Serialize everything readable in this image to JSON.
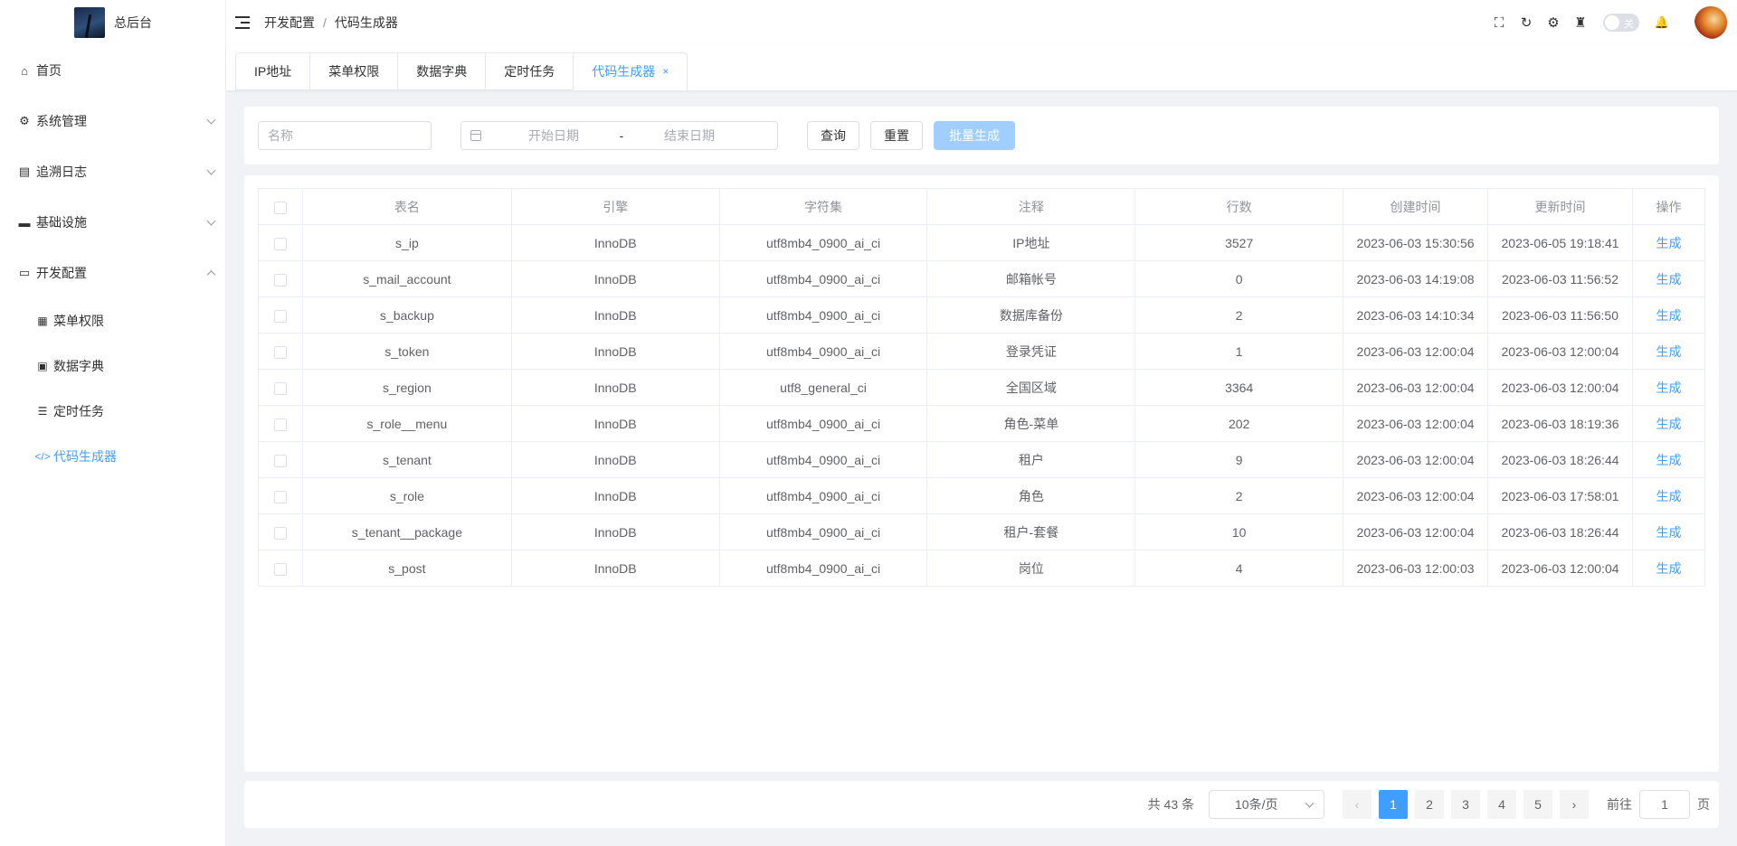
{
  "app": {
    "title": "总后台"
  },
  "sidebar": {
    "items": [
      {
        "label": "首页",
        "icon": "home-icon",
        "glyph": "⌂",
        "expandable": false
      },
      {
        "label": "系统管理",
        "icon": "gear-icon",
        "glyph": "⚙",
        "expandable": true,
        "expanded": false
      },
      {
        "label": "追溯日志",
        "icon": "log-icon",
        "glyph": "▤",
        "expandable": true,
        "expanded": false
      },
      {
        "label": "基础设施",
        "icon": "folder-icon",
        "glyph": "▬",
        "expandable": true,
        "expanded": false
      },
      {
        "label": "开发配置",
        "icon": "monitor-icon",
        "glyph": "▭",
        "expandable": true,
        "expanded": true
      }
    ],
    "subitems": [
      {
        "label": "菜单权限",
        "icon": "grid-icon",
        "glyph": "▦",
        "active": false
      },
      {
        "label": "数据字典",
        "icon": "book-icon",
        "glyph": "▣",
        "active": false
      },
      {
        "label": "定时任务",
        "icon": "list-icon",
        "glyph": "☰",
        "active": false
      },
      {
        "label": "代码生成器",
        "icon": "code-icon",
        "glyph": "</>",
        "active": true
      }
    ]
  },
  "header": {
    "breadcrumb": [
      "开发配置",
      "代码生成器"
    ],
    "breadcrumb_sep": "/",
    "icons": [
      {
        "name": "fullscreen-icon",
        "glyph": "⛶"
      },
      {
        "name": "refresh-icon",
        "glyph": "↻"
      },
      {
        "name": "settings-icon",
        "glyph": "⚙"
      },
      {
        "name": "broom-icon",
        "glyph": "♜"
      }
    ],
    "toggle_label": "关",
    "bell_glyph": "🔔"
  },
  "tabs": [
    {
      "label": "IP地址",
      "active": false
    },
    {
      "label": "菜单权限",
      "active": false
    },
    {
      "label": "数据字典",
      "active": false
    },
    {
      "label": "定时任务",
      "active": false
    },
    {
      "label": "代码生成器",
      "active": true,
      "closable": true
    }
  ],
  "filter": {
    "name_placeholder": "名称",
    "start_placeholder": "开始日期",
    "range_separator": "-",
    "end_placeholder": "结束日期",
    "query_label": "查询",
    "reset_label": "重置",
    "batch_label": "批量生成"
  },
  "table": {
    "columns": [
      "表名",
      "引擎",
      "字符集",
      "注释",
      "行数",
      "创建时间",
      "更新时间",
      "操作"
    ],
    "action_label": "生成",
    "rows": [
      [
        "s_ip",
        "InnoDB",
        "utf8mb4_0900_ai_ci",
        "IP地址",
        "3527",
        "2023-06-03 15:30:56",
        "2023-06-05 19:18:41"
      ],
      [
        "s_mail_account",
        "InnoDB",
        "utf8mb4_0900_ai_ci",
        "邮箱帐号",
        "0",
        "2023-06-03 14:19:08",
        "2023-06-03 11:56:52"
      ],
      [
        "s_backup",
        "InnoDB",
        "utf8mb4_0900_ai_ci",
        "数据库备份",
        "2",
        "2023-06-03 14:10:34",
        "2023-06-03 11:56:50"
      ],
      [
        "s_token",
        "InnoDB",
        "utf8mb4_0900_ai_ci",
        "登录凭证",
        "1",
        "2023-06-03 12:00:04",
        "2023-06-03 12:00:04"
      ],
      [
        "s_region",
        "InnoDB",
        "utf8_general_ci",
        "全国区域",
        "3364",
        "2023-06-03 12:00:04",
        "2023-06-03 12:00:04"
      ],
      [
        "s_role__menu",
        "InnoDB",
        "utf8mb4_0900_ai_ci",
        "角色-菜单",
        "202",
        "2023-06-03 12:00:04",
        "2023-06-03 18:19:36"
      ],
      [
        "s_tenant",
        "InnoDB",
        "utf8mb4_0900_ai_ci",
        "租户",
        "9",
        "2023-06-03 12:00:04",
        "2023-06-03 18:26:44"
      ],
      [
        "s_role",
        "InnoDB",
        "utf8mb4_0900_ai_ci",
        "角色",
        "2",
        "2023-06-03 12:00:04",
        "2023-06-03 17:58:01"
      ],
      [
        "s_tenant__package",
        "InnoDB",
        "utf8mb4_0900_ai_ci",
        "租户-套餐",
        "10",
        "2023-06-03 12:00:04",
        "2023-06-03 18:26:44"
      ],
      [
        "s_post",
        "InnoDB",
        "utf8mb4_0900_ai_ci",
        "岗位",
        "4",
        "2023-06-03 12:00:03",
        "2023-06-03 12:00:04"
      ]
    ]
  },
  "pagination": {
    "total_text": "共 43 条",
    "page_size": "10条/页",
    "pages": [
      "1",
      "2",
      "3",
      "4",
      "5"
    ],
    "current": "1",
    "prev_glyph": "‹",
    "next_glyph": "›",
    "goto_label": "前往",
    "goto_value": "1",
    "goto_suffix": "页"
  },
  "colors": {
    "accent": "#409eff",
    "accent_light": "#a0cfff",
    "background": "#f0f2f5"
  }
}
